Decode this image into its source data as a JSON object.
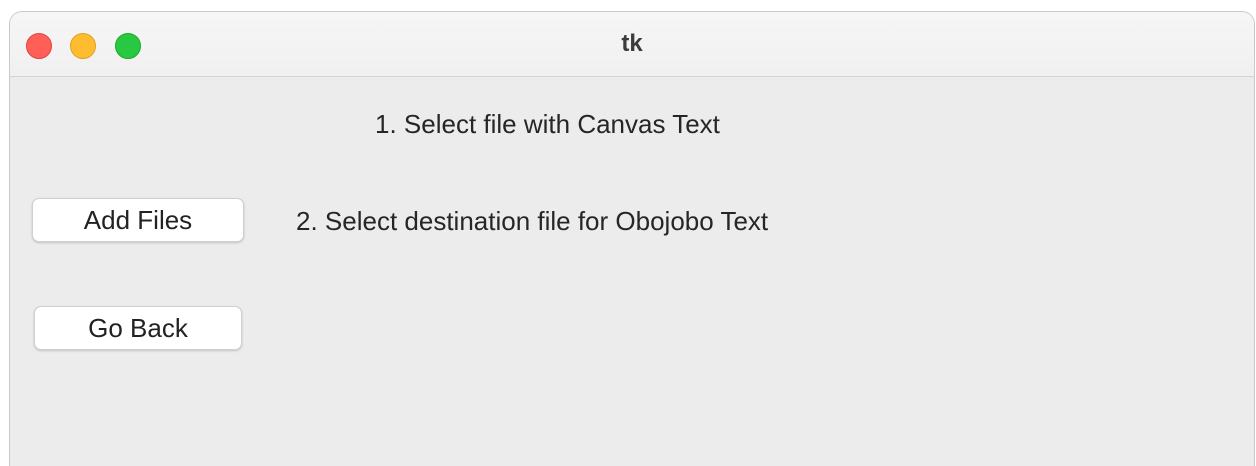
{
  "window": {
    "title": "tk"
  },
  "content": {
    "step1_label": "1. Select file with Canvas Text",
    "step2_label": "2. Select destination file for Obojobo Text"
  },
  "buttons": {
    "add_files": "Add Files",
    "go_back": "Go Back"
  },
  "colors": {
    "close": "#fe5f57",
    "minimize": "#febc2e",
    "zoom": "#28c840",
    "window_background": "#ececec"
  }
}
